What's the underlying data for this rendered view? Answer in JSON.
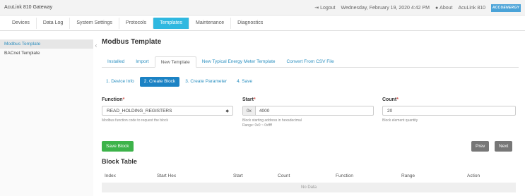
{
  "topbar": {
    "app_title": "AcuLink 810 Gateway",
    "logout": "Logout",
    "datetime": "Wednesday, February 19, 2020 4:42 PM",
    "about": "About",
    "device": "AcuLink 810",
    "logo_text": "ACCUENERGY"
  },
  "nav": [
    "Devices",
    "Data Log",
    "System Settings",
    "Protocols",
    "Templates",
    "Maintenance",
    "Diagnostics"
  ],
  "sidebar": {
    "items": [
      "Modbus Template",
      "BACnet Template"
    ],
    "collapse_glyph": "‹"
  },
  "main": {
    "title": "Modbus Template",
    "tabs": [
      "Installed",
      "Import",
      "New Template",
      "New Typical Energy Meter Template",
      "Convert From CSV File"
    ],
    "steps": [
      "1. Device Info",
      "2. Create Block",
      "3. Create Parameter",
      "4. Save"
    ],
    "function": {
      "label": "Function",
      "value": "READ_HOLDING_REGISTERS",
      "help": "Modbus function code to request the block"
    },
    "start": {
      "label": "Start",
      "prefix": "0x",
      "value": "4000",
      "help1": "Block starting address in hexadecimal",
      "help2": "Range: 0x0 ~ 0xffff"
    },
    "count": {
      "label": "Count",
      "value": "20",
      "help": "Block element quantity"
    },
    "save_block": "Save Block",
    "prev": "Prev",
    "next": "Next",
    "block_table": {
      "title": "Block Table",
      "columns": [
        "Index",
        "Start Hex",
        "Start",
        "Count",
        "Function",
        "Range",
        "Action"
      ],
      "empty": "No Data"
    }
  }
}
